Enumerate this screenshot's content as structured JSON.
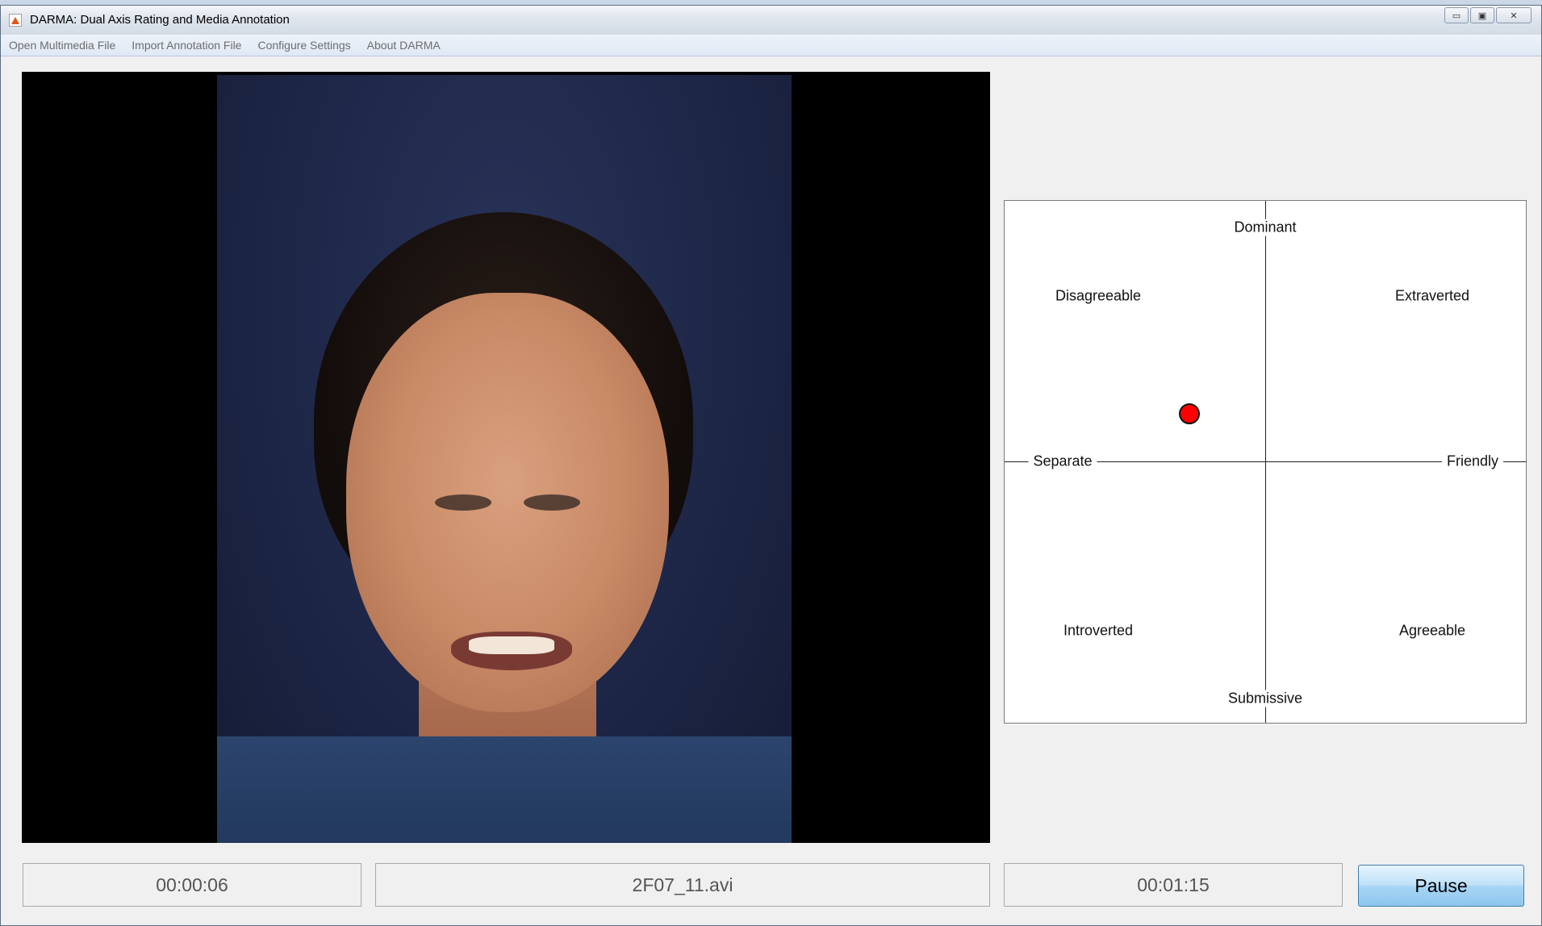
{
  "window": {
    "title": "DARMA: Dual Axis Rating and Media Annotation",
    "controls": {
      "minimize": "▭",
      "maximize": "▣",
      "close": "✕"
    }
  },
  "menu": {
    "items": [
      "Open Multimedia File",
      "Import Annotation File",
      "Configure Settings",
      "About DARMA"
    ]
  },
  "rating_grid": {
    "labels": {
      "top": "Dominant",
      "bottom": "Submissive",
      "left": "Separate",
      "right": "Friendly",
      "top_left": "Disagreeable",
      "top_right": "Extraverted",
      "bottom_left": "Introverted",
      "bottom_right": "Agreeable"
    },
    "marker_color": "#ff0000"
  },
  "status": {
    "elapsed": "00:00:06",
    "filename": "2F07_11.avi",
    "duration": "00:01:15"
  },
  "controls": {
    "pause_label": "Pause"
  }
}
